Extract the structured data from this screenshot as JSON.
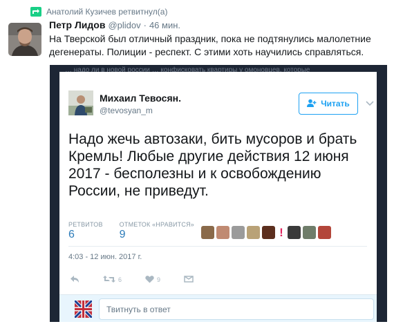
{
  "retweet": {
    "text": "Анатолий Кузичев ретвитнул(а)"
  },
  "tweet": {
    "author": "Петр Лидов",
    "handle": "@plidov",
    "separator": "·",
    "time": "46 мин.",
    "text": "На Тверской был отличный праздник, пока не подтянулись малолетние дегенераты. Полиции - респект.  С этими хоть научились справляться."
  },
  "embed": {
    "bleed_text": "… надо ли в новой россии … конфисковать квартиры у омоновцев, которые",
    "author": "Михаил Тевосян.",
    "handle": "@tevosyan_m",
    "follow_label": "Читать",
    "text": "Надо жечь автозаки, бить мусоров и брать Кремль! Любые другие действия 12 июня 2017 - бесполезны и к освобождению России, не приведут.",
    "stats": {
      "retweets_label": "РЕТВИТОВ",
      "retweets": "6",
      "likes_label": "ОТМЕТОК «НРАВИТСЯ»",
      "likes": "9"
    },
    "likers_colors": [
      "#8a6a4a",
      "#c08a72",
      "#9b9b9b",
      "#b9a277",
      "#5c2f1e",
      "#3a3a3a",
      "#6f7d6a",
      "#b3463a"
    ],
    "timestamp": "4:03 - 12 июн. 2017 г.",
    "actions": {
      "retweets": "6",
      "likes": "9"
    },
    "reply_placeholder": "Твитнуть в ответ"
  },
  "colors": {
    "accent": "#1da1f2",
    "retweet_green": "#19cf86",
    "embed_bg": "#1d2635",
    "reply_bg": "#e8f5fd"
  }
}
